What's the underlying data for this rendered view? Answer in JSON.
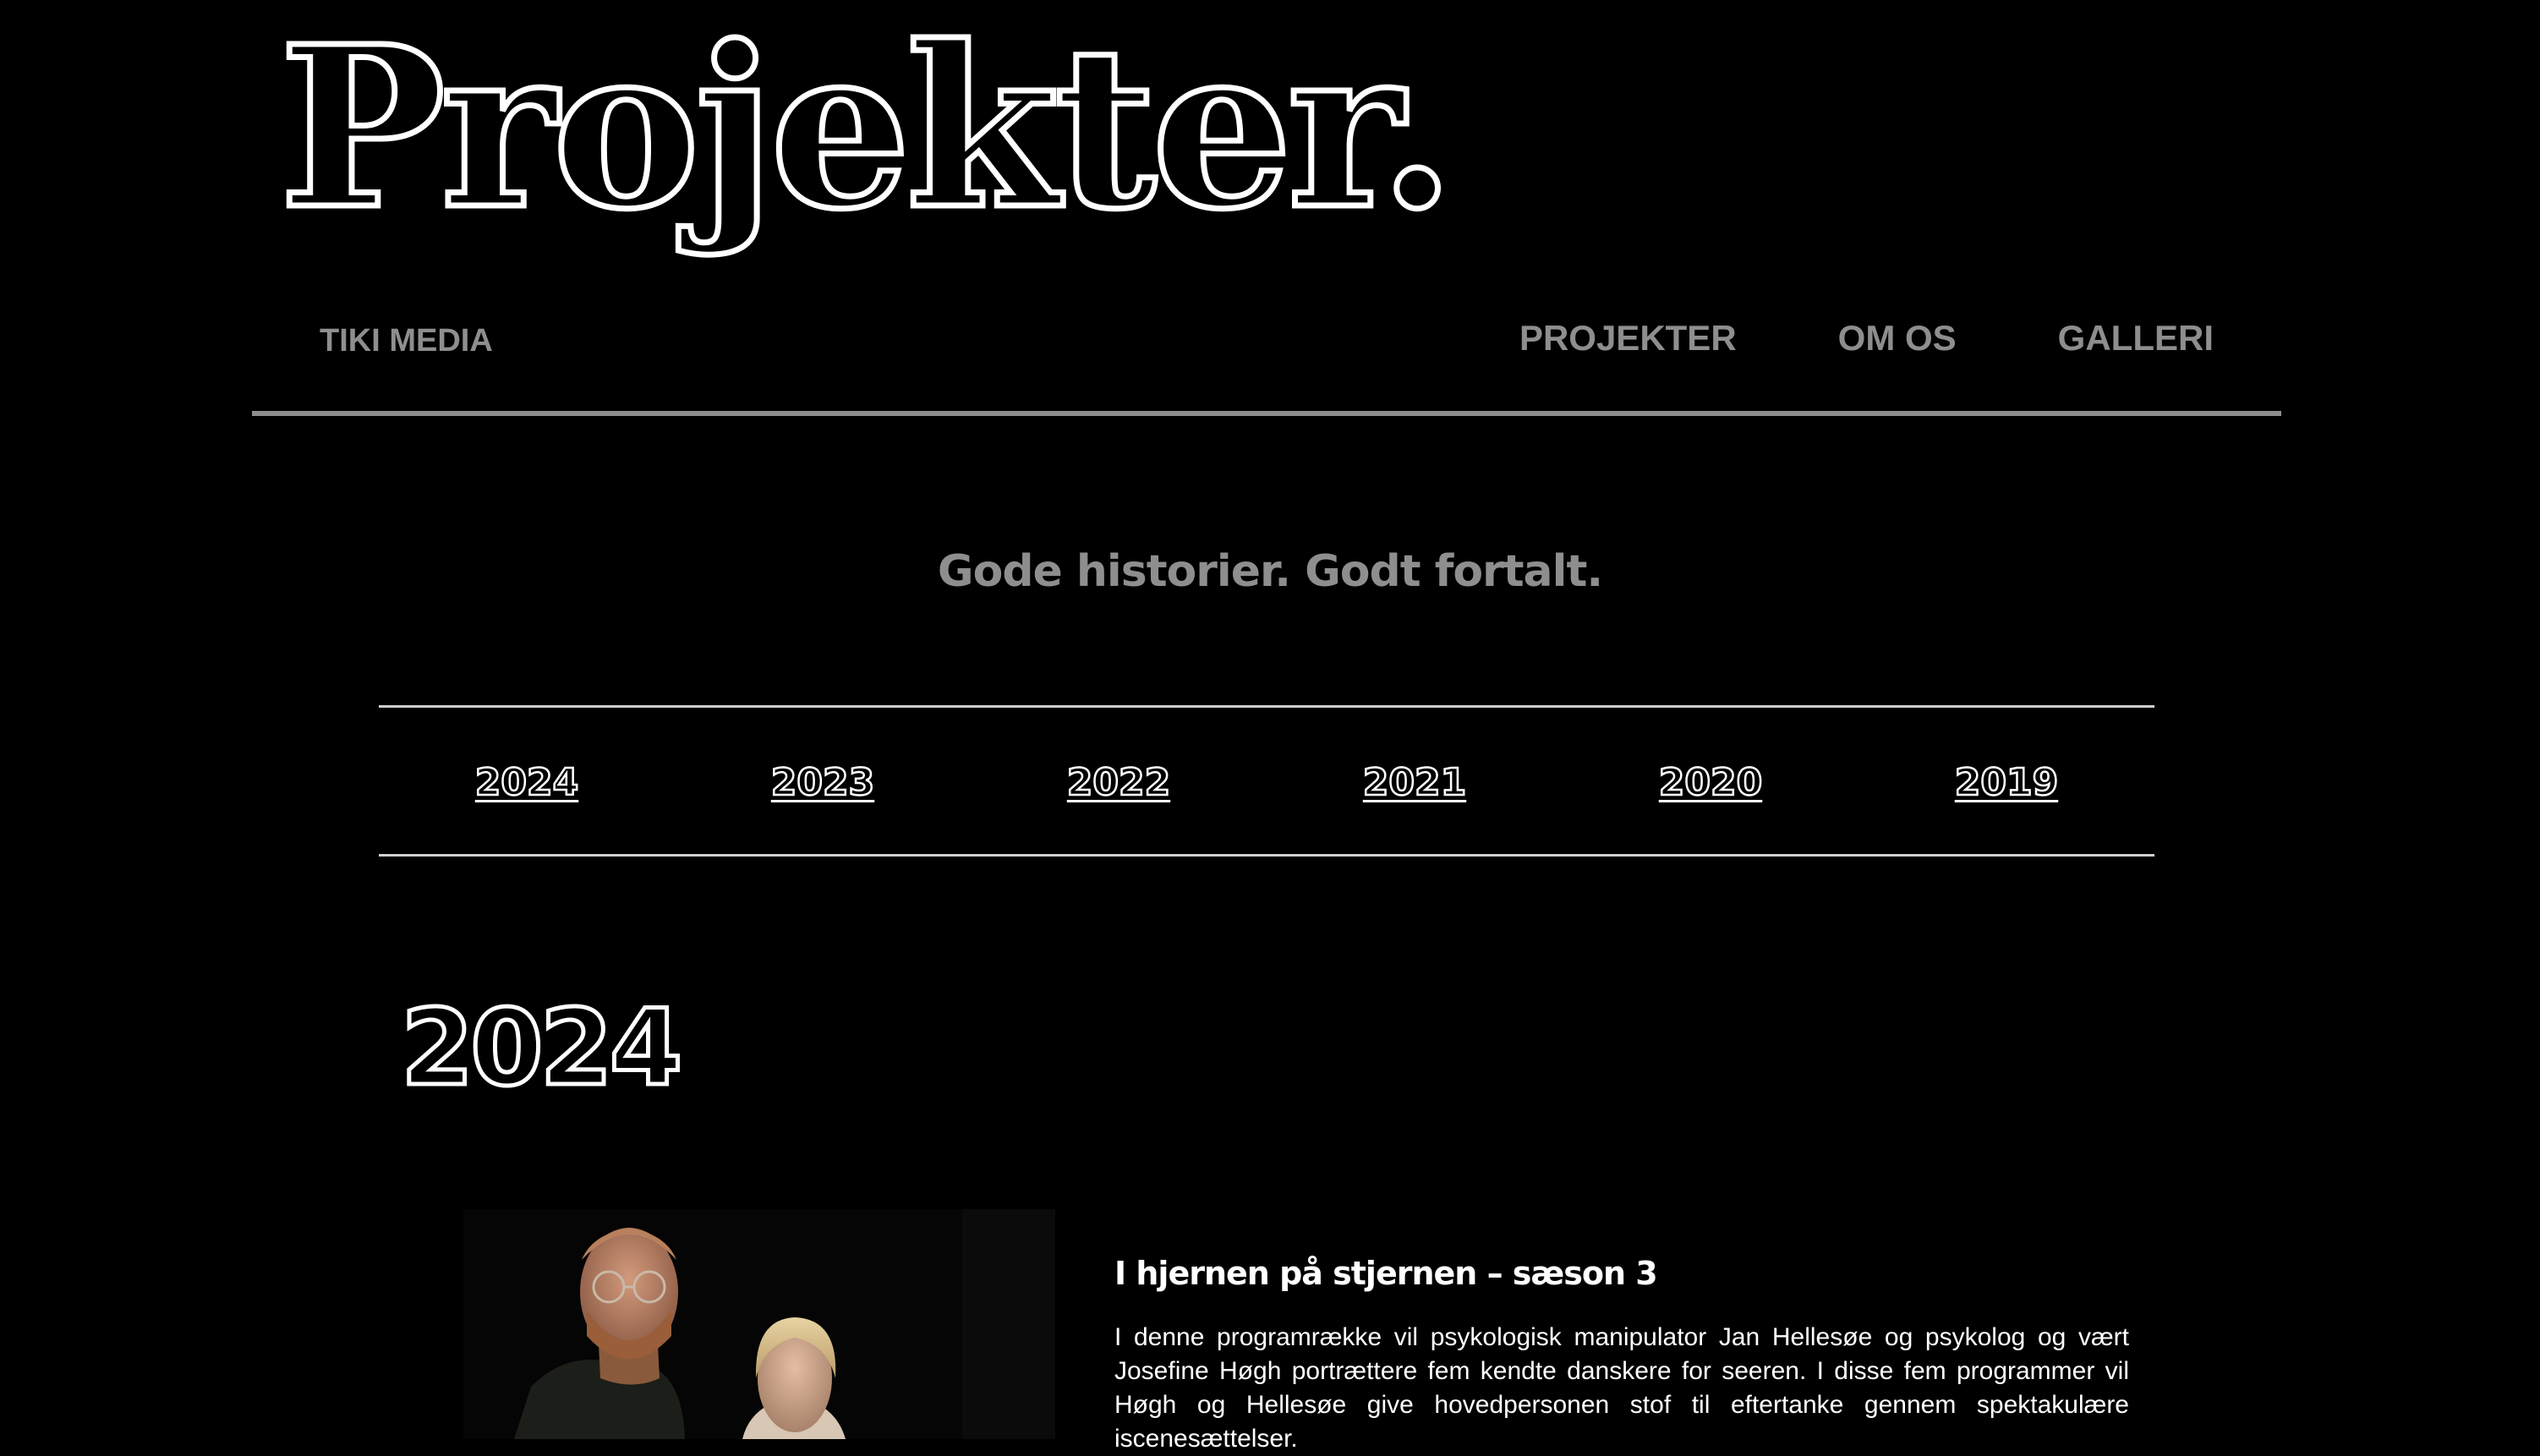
{
  "hero": {
    "title": "Projekter."
  },
  "nav": {
    "brand": "TIKI MEDIA",
    "links": [
      "PROJEKTER",
      "OM OS",
      "GALLERI"
    ]
  },
  "tagline": "Gode historier. Godt fortalt.",
  "years": [
    "2024",
    "2023",
    "2022",
    "2021",
    "2020",
    "2019"
  ],
  "section": {
    "year": "2024"
  },
  "project": {
    "title": "I hjernen på stjernen – sæson 3",
    "description": "I denne programrække vil psykologisk manipulator Jan Hellesøe og psykolog og vært Josefine Høgh portrættere fem kendte danskere for seeren. I disse fem programmer vil Høgh og Hellesøe give hovedpersonen stof til eftertanke gennem spektakulære iscenesættelser."
  },
  "colors": {
    "background": "#000000",
    "muted_text": "#8e8e8e",
    "outline": "#ffffff"
  }
}
